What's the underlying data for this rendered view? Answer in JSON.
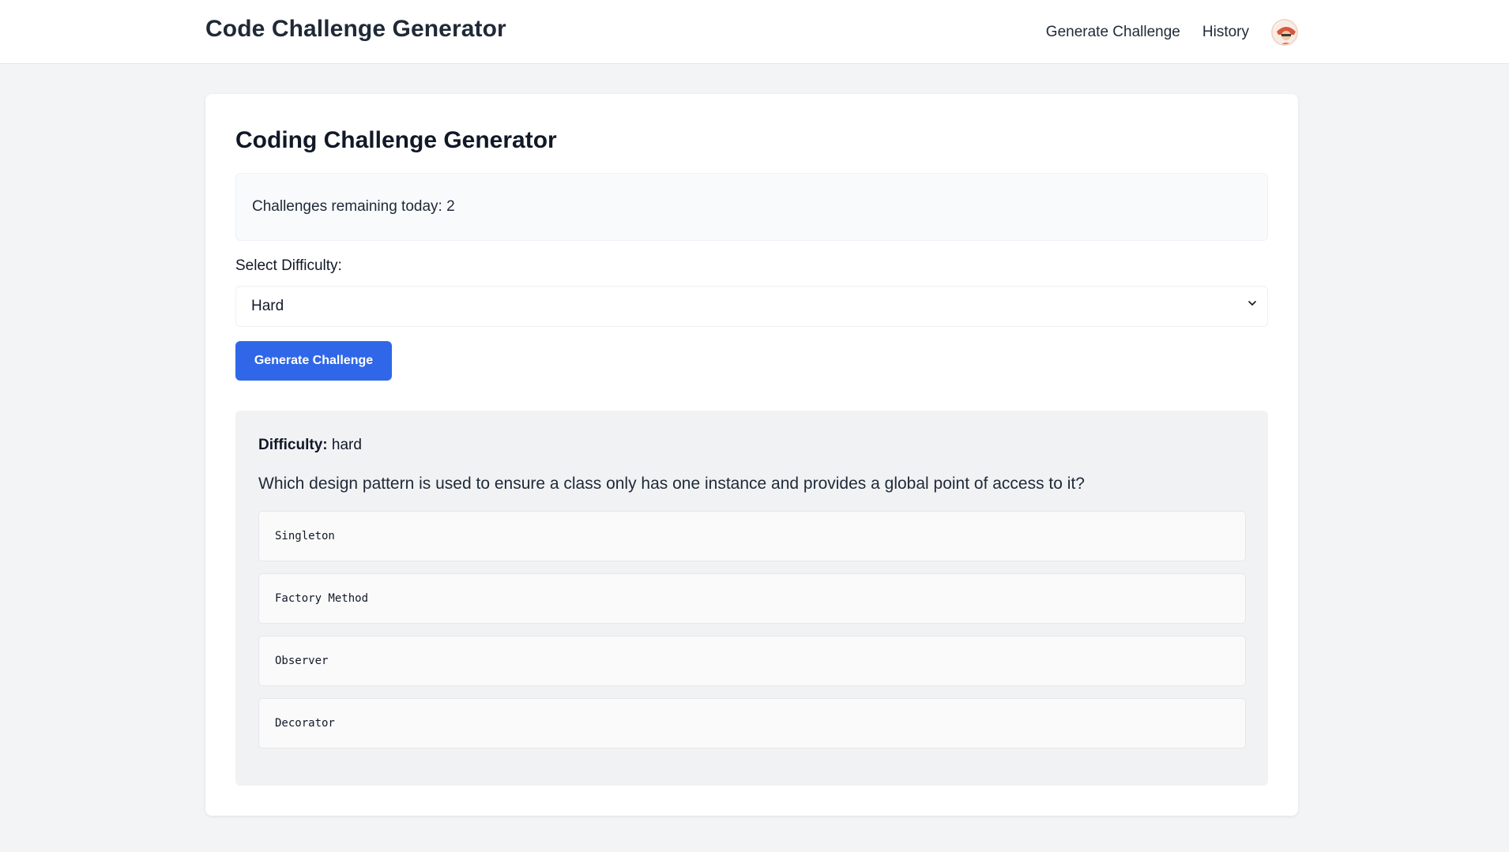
{
  "header": {
    "brand": "Code Challenge Generator",
    "nav": [
      {
        "label": "Generate Challenge"
      },
      {
        "label": "History"
      }
    ],
    "avatar_icon": "user-avatar"
  },
  "main": {
    "title": "Coding Challenge Generator",
    "remaining_text": "Challenges remaining today: 2",
    "difficulty_label": "Select Difficulty:",
    "difficulty_selected": "Hard",
    "generate_button": "Generate Challenge"
  },
  "challenge": {
    "difficulty_label": "Difficulty:",
    "difficulty_value": "hard",
    "question": "Which design pattern is used to ensure a class only has one instance and provides a global point of access to it?",
    "options": [
      {
        "label": "Singleton"
      },
      {
        "label": "Factory Method"
      },
      {
        "label": "Observer"
      },
      {
        "label": "Decorator"
      }
    ]
  },
  "colors": {
    "accent": "#2f67e8",
    "page_bg": "#f3f4f6",
    "card_bg": "#ffffff",
    "result_bg": "#f1f2f4"
  }
}
